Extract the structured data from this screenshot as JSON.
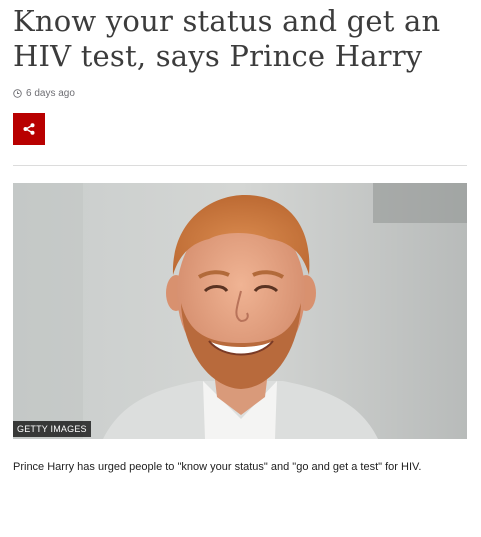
{
  "article": {
    "headline": "Know your status and get an HIV test, says Prince Harry",
    "timestamp": "6 days ago",
    "share_icon": "share-icon",
    "share_color": "#b80000",
    "image_credit": "GETTY IMAGES",
    "caption": "Prince Harry has urged people to \"know your status\" and \"go and get a test\" for HIV."
  }
}
